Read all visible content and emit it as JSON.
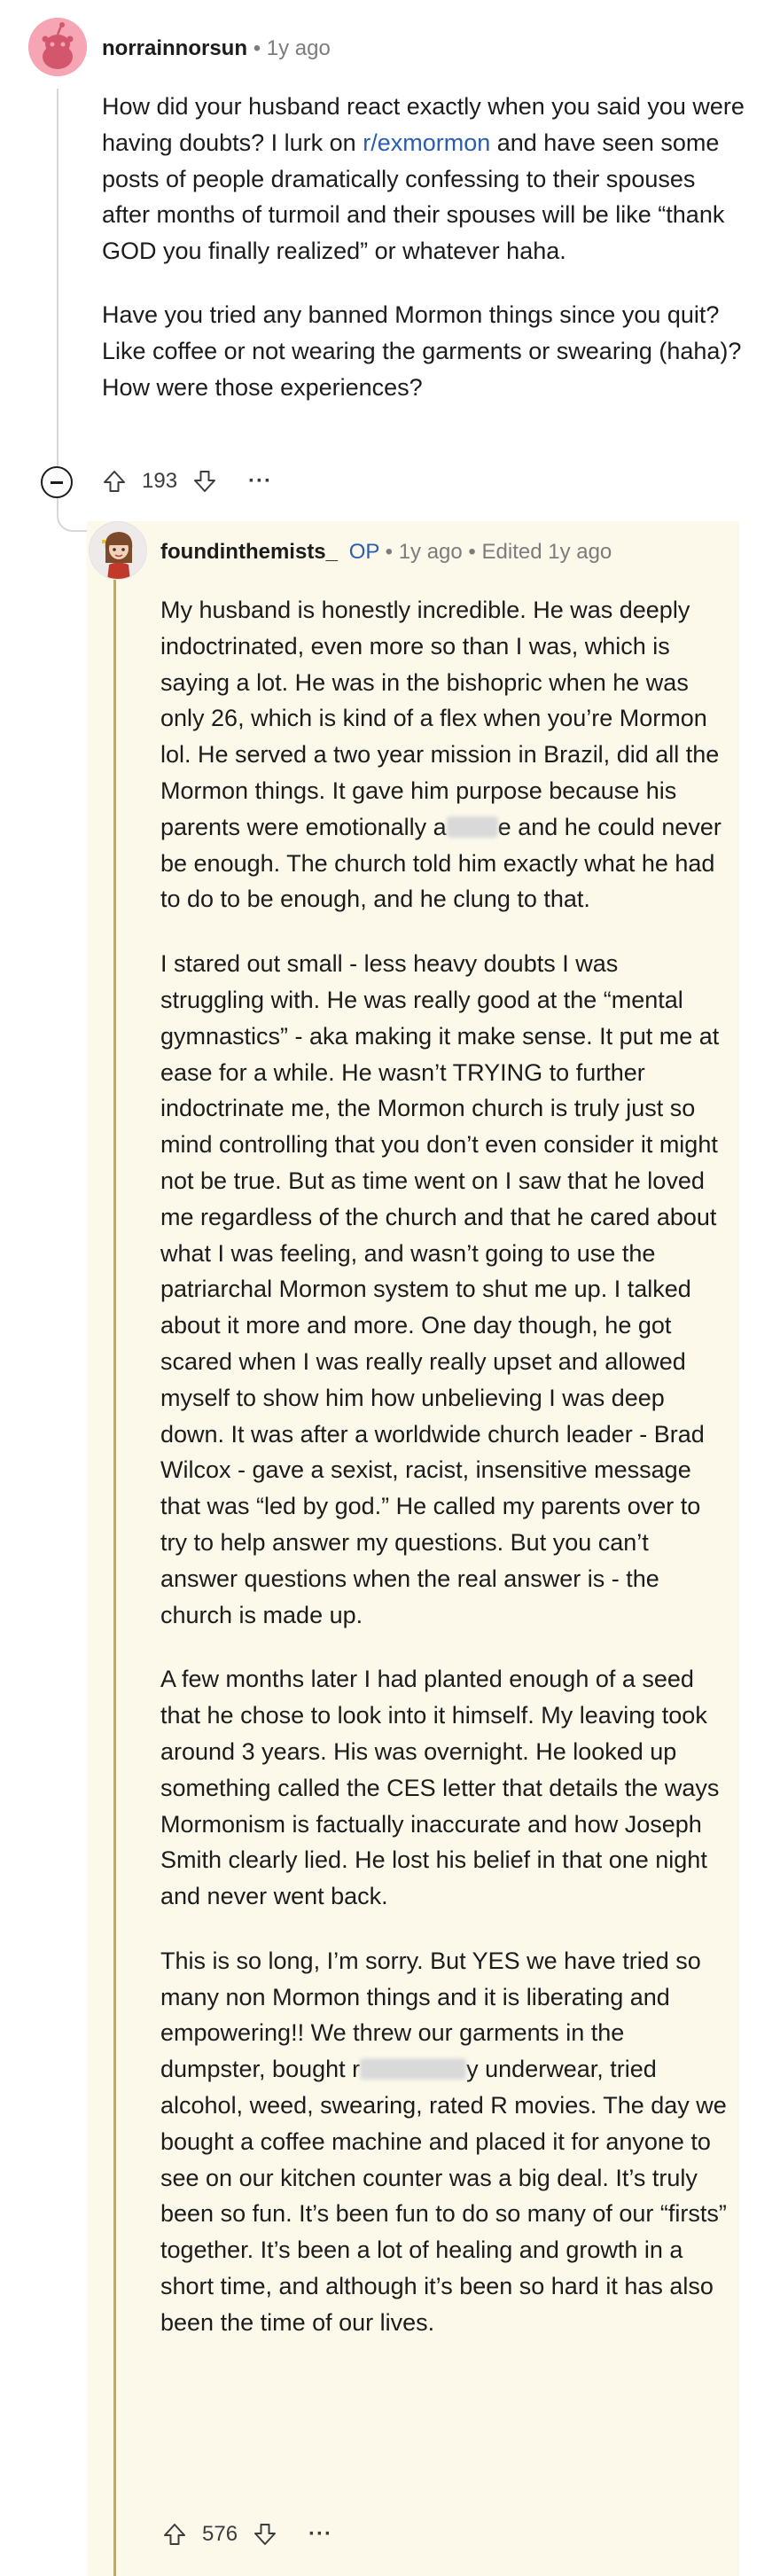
{
  "parent_comment": {
    "username": "norrainnorsun",
    "separator": "•",
    "time": "1y ago",
    "paragraph1_a": "How did your husband react exactly when you said you were having doubts? I lurk on ",
    "link": "r/exmormon",
    "paragraph1_b": " and have seen some posts of people dramatically confessing to their spouses after months of turmoil and their spouses will be like “thank GOD you finally realized” or whatever haha.",
    "paragraph2": "Have you tried any banned Mormon things since you quit? Like coffee or not wearing the garments or swearing (haha)? How were those experiences?",
    "votes": "193",
    "more": "···"
  },
  "reply": {
    "username": "foundinthemists_",
    "op_badge": "OP",
    "separator1": "•",
    "time": "1y ago",
    "separator2": "•",
    "edited": "Edited 1y ago",
    "p1_a": "My husband is honestly incredible. He was deeply indoctrinated, even more so than I was, which is saying a lot. He was in the bishopric when he was only 26, which is kind of a flex when you’re Mormon lol. He served a two year mission in Brazil, did all the Mormon things. It gave him purpose because his parents were emotionally a",
    "p1_b": "e and he could never be enough. The church told him exactly what he had to do to be enough, and he clung to that.",
    "p2": "I stared out small - less heavy doubts I was struggling with. He was really good at the “mental gymnastics” - aka making it make sense. It put me at ease for a while. He wasn’t TRYING to further indoctrinate me, the Mormon church is truly just so mind controlling that you don’t even consider it might not be true. But as time went on I saw that he loved me regardless of the church and that he cared about what I was feeling, and wasn’t going to use the patriarchal Mormon system to shut me up. I talked about it more and more. One day though, he got scared when I was really really upset and allowed myself to show him how unbelieving I was deep down. It was after a worldwide church leader - Brad Wilcox - gave a sexist, racist, insensitive message that was “led by god.” He called my parents over to try to help answer my questions. But you can’t answer questions when the real answer is - the church is made up.",
    "p3": "A few months later I had planted enough of a seed that he chose to look into it himself. My leaving took around 3 years. His was overnight. He looked up something called the CES letter that details the ways Mormonism is factually inaccurate and how Joseph Smith clearly lied. He lost his belief in that one night and never went back.",
    "p4_a": "This is so long, I’m sorry. But YES we have tried so many non Mormon things and it is liberating and empowering!! We threw our garments in the dumpster, bought r",
    "p4_b": "y underwear, tried alcohol, weed, swearing, rated R movies. The day we bought a coffee machine and placed it for anyone to see on our kitchen counter was a big deal. It’s truly been so fun. It’s been fun to do so many of our “firsts” together. It’s been a lot of healing and growth in a short time, and although it’s been so hard it has also been the time of our lives.",
    "votes": "576",
    "more": "···"
  },
  "icons": {
    "parent_avatar": "reddit-snoo-avatar-icon",
    "reply_avatar": "character-avatar-icon",
    "collapse": "collapse-thread-icon",
    "upvote": "upvote-arrow-icon",
    "downvote": "downvote-arrow-icon"
  },
  "colors": {
    "link": "#2a5db0",
    "op_highlight_bg": "#fcf9eb",
    "op_thread_line": "#b8ab6d",
    "parent_avatar_bg": "#f6a5b4"
  }
}
